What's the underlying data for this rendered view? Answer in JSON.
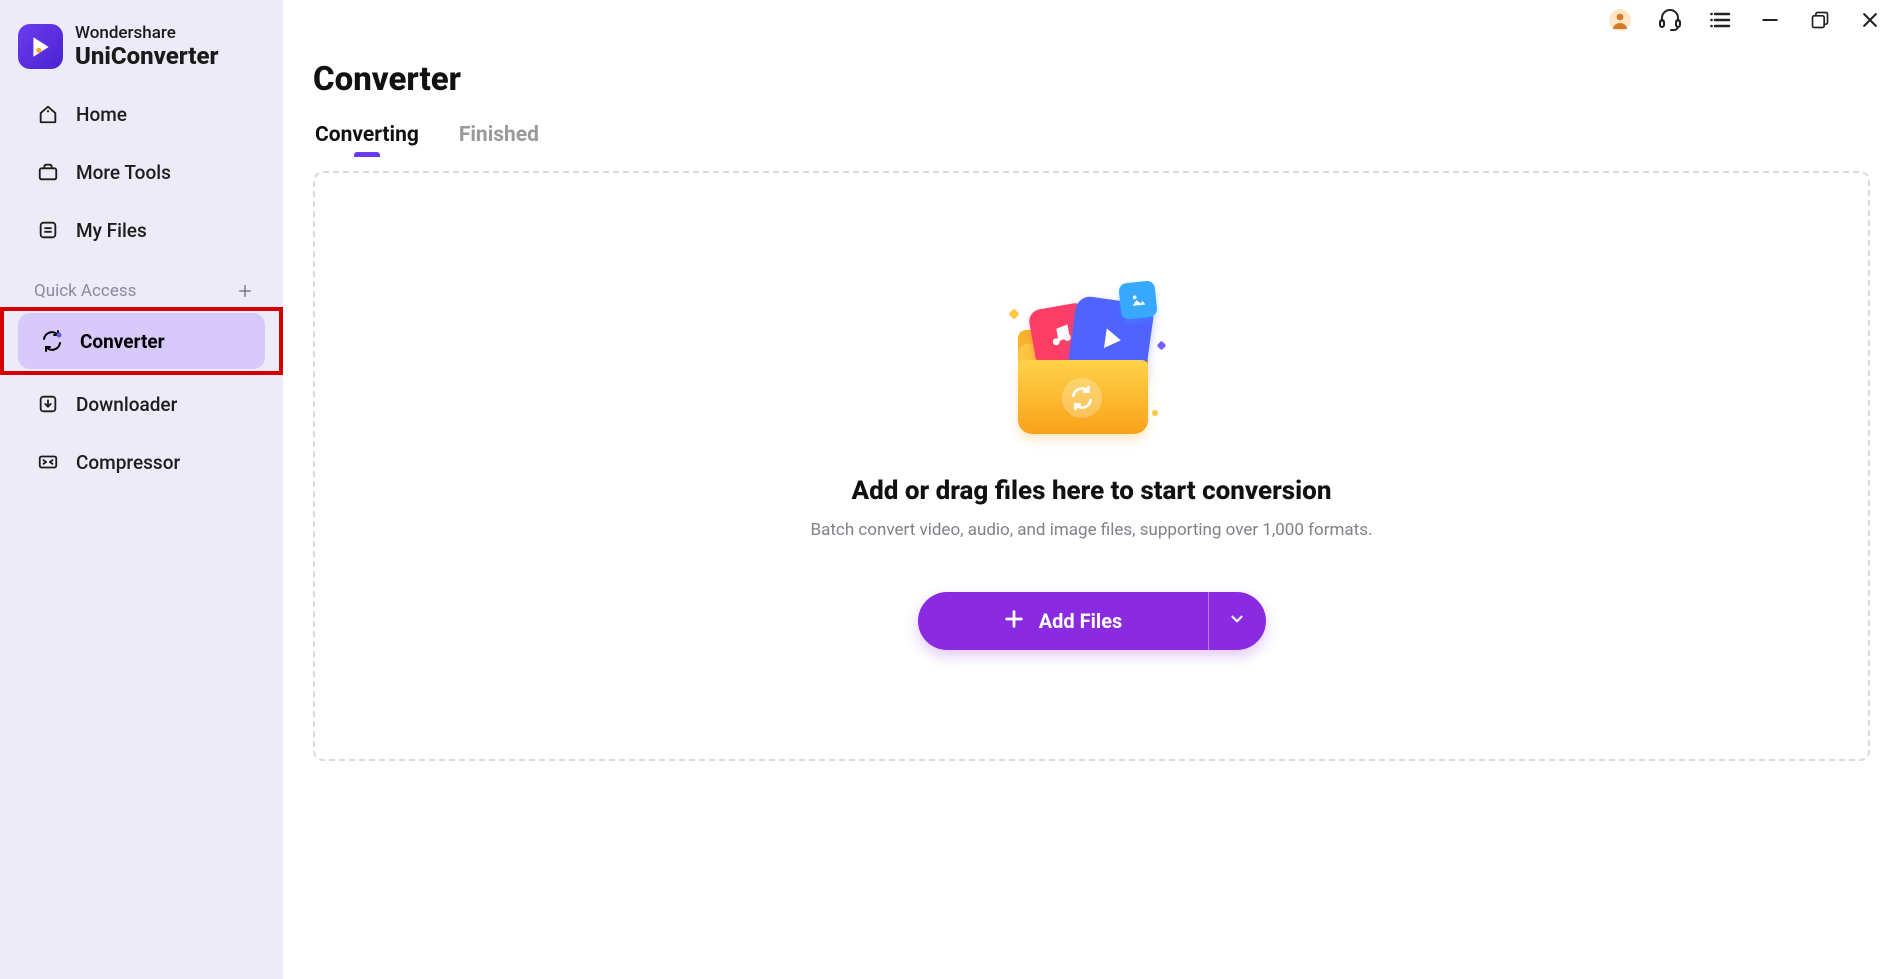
{
  "brand": {
    "line1": "Wondershare",
    "line2": "UniConverter"
  },
  "sidebar": {
    "items": [
      {
        "label": "Home"
      },
      {
        "label": "More Tools"
      },
      {
        "label": "My Files"
      }
    ],
    "quick_access_header": "Quick Access",
    "quick_items": [
      {
        "label": "Converter"
      },
      {
        "label": "Downloader"
      },
      {
        "label": "Compressor"
      }
    ]
  },
  "page": {
    "title": "Converter"
  },
  "tabs": [
    {
      "label": "Converting"
    },
    {
      "label": "Finished"
    }
  ],
  "dropzone": {
    "heading": "Add or drag files here to start conversion",
    "sub": "Batch convert video, audio, and image files, supporting over 1,000 formats."
  },
  "actions": {
    "add_files": "Add Files"
  }
}
